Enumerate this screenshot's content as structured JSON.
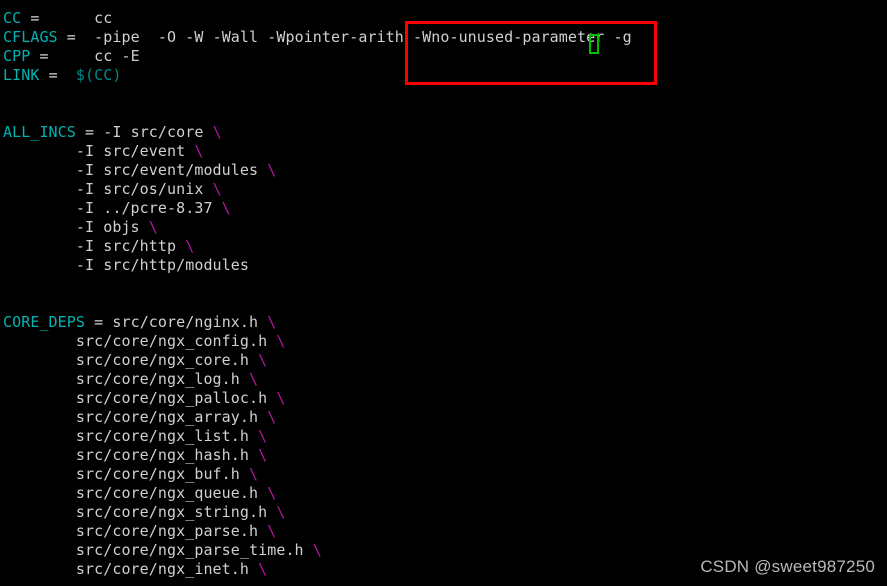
{
  "window": {
    "title": "Makefile",
    "background_color": "#000000"
  },
  "colors": {
    "variable": "#00b3b3",
    "equals": "#d8d8d8",
    "value": "#d0d0d0",
    "macro_reference": "#008b8b",
    "continuation": "#b3179e",
    "annotation_border": "#fe0000",
    "cursor_border": "#00c000",
    "watermark": "#c8c8c8"
  },
  "annotation": {
    "shape": "rectangle",
    "highlighted_text": "-Wno-unused-parameter -g"
  },
  "cursor": {
    "character": "r",
    "shape": "box-outline"
  },
  "watermark": {
    "text": "CSDN @sweet987250"
  },
  "code": {
    "lines": [
      {
        "var": "CC",
        "eq": " =",
        "sep": "      ",
        "val": "cc",
        "ref": "",
        "cont": ""
      },
      {
        "var": "CFLAGS",
        "eq": " =",
        "sep": "  ",
        "val": "-pipe  -O -W -Wall -Wpointer-arith -Wno-unused-parameter -g",
        "ref": "",
        "cont": ""
      },
      {
        "var": "CPP",
        "eq": " =",
        "sep": "     ",
        "val": "cc -E",
        "ref": "",
        "cont": ""
      },
      {
        "var": "LINK",
        "eq": " =",
        "sep": "  ",
        "val": "",
        "ref": "$(CC)",
        "cont": ""
      },
      {
        "var": "",
        "eq": "",
        "sep": "",
        "val": "",
        "ref": "",
        "cont": ""
      },
      {
        "var": "",
        "eq": "",
        "sep": "",
        "val": "",
        "ref": "",
        "cont": ""
      },
      {
        "var": "ALL_INCS",
        "eq": " =",
        "sep": " ",
        "val": "-I src/core ",
        "ref": "",
        "cont": "\\"
      },
      {
        "var": "",
        "eq": "",
        "sep": "        ",
        "val": "-I src/event ",
        "ref": "",
        "cont": "\\"
      },
      {
        "var": "",
        "eq": "",
        "sep": "        ",
        "val": "-I src/event/modules ",
        "ref": "",
        "cont": "\\"
      },
      {
        "var": "",
        "eq": "",
        "sep": "        ",
        "val": "-I src/os/unix ",
        "ref": "",
        "cont": "\\"
      },
      {
        "var": "",
        "eq": "",
        "sep": "        ",
        "val": "-I ../pcre-8.37 ",
        "ref": "",
        "cont": "\\"
      },
      {
        "var": "",
        "eq": "",
        "sep": "        ",
        "val": "-I objs ",
        "ref": "",
        "cont": "\\"
      },
      {
        "var": "",
        "eq": "",
        "sep": "        ",
        "val": "-I src/http ",
        "ref": "",
        "cont": "\\"
      },
      {
        "var": "",
        "eq": "",
        "sep": "        ",
        "val": "-I src/http/modules",
        "ref": "",
        "cont": ""
      },
      {
        "var": "",
        "eq": "",
        "sep": "",
        "val": "",
        "ref": "",
        "cont": ""
      },
      {
        "var": "",
        "eq": "",
        "sep": "",
        "val": "",
        "ref": "",
        "cont": ""
      },
      {
        "var": "CORE_DEPS",
        "eq": " =",
        "sep": " ",
        "val": "src/core/nginx.h ",
        "ref": "",
        "cont": "\\"
      },
      {
        "var": "",
        "eq": "",
        "sep": "        ",
        "val": "src/core/ngx_config.h ",
        "ref": "",
        "cont": "\\"
      },
      {
        "var": "",
        "eq": "",
        "sep": "        ",
        "val": "src/core/ngx_core.h ",
        "ref": "",
        "cont": "\\"
      },
      {
        "var": "",
        "eq": "",
        "sep": "        ",
        "val": "src/core/ngx_log.h ",
        "ref": "",
        "cont": "\\"
      },
      {
        "var": "",
        "eq": "",
        "sep": "        ",
        "val": "src/core/ngx_palloc.h ",
        "ref": "",
        "cont": "\\"
      },
      {
        "var": "",
        "eq": "",
        "sep": "        ",
        "val": "src/core/ngx_array.h ",
        "ref": "",
        "cont": "\\"
      },
      {
        "var": "",
        "eq": "",
        "sep": "        ",
        "val": "src/core/ngx_list.h ",
        "ref": "",
        "cont": "\\"
      },
      {
        "var": "",
        "eq": "",
        "sep": "        ",
        "val": "src/core/ngx_hash.h ",
        "ref": "",
        "cont": "\\"
      },
      {
        "var": "",
        "eq": "",
        "sep": "        ",
        "val": "src/core/ngx_buf.h ",
        "ref": "",
        "cont": "\\"
      },
      {
        "var": "",
        "eq": "",
        "sep": "        ",
        "val": "src/core/ngx_queue.h ",
        "ref": "",
        "cont": "\\"
      },
      {
        "var": "",
        "eq": "",
        "sep": "        ",
        "val": "src/core/ngx_string.h ",
        "ref": "",
        "cont": "\\"
      },
      {
        "var": "",
        "eq": "",
        "sep": "        ",
        "val": "src/core/ngx_parse.h ",
        "ref": "",
        "cont": "\\"
      },
      {
        "var": "",
        "eq": "",
        "sep": "        ",
        "val": "src/core/ngx_parse_time.h ",
        "ref": "",
        "cont": "\\"
      },
      {
        "var": "",
        "eq": "",
        "sep": "        ",
        "val": "src/core/ngx_inet.h ",
        "ref": "",
        "cont": "\\"
      }
    ]
  }
}
